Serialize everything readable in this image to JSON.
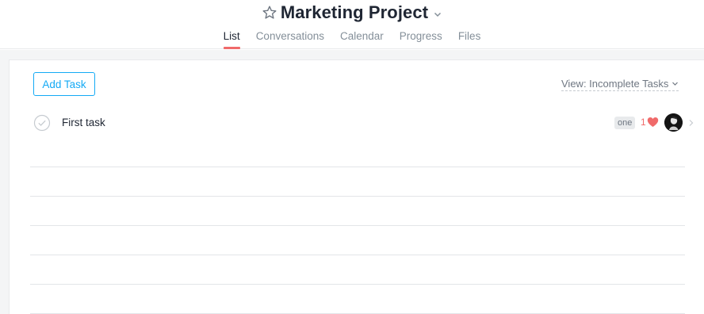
{
  "header": {
    "project_title": "Marketing Project",
    "tabs": [
      {
        "label": "List",
        "active": true
      },
      {
        "label": "Conversations",
        "active": false
      },
      {
        "label": "Calendar",
        "active": false
      },
      {
        "label": "Progress",
        "active": false
      },
      {
        "label": "Files",
        "active": false
      }
    ],
    "icons": {
      "favorite": "star-outline-icon",
      "menu": "chevron-down-icon"
    }
  },
  "toolbar": {
    "add_task_label": "Add Task",
    "view_filter_label": "View: Incomplete Tasks"
  },
  "tasks": [
    {
      "name": "First task",
      "tag": "one",
      "likes": "1",
      "completed": false
    }
  ],
  "colors": {
    "accent": "#14aaf5",
    "active_tab_underline": "#f06a6a",
    "heart": "#f06a6a"
  }
}
